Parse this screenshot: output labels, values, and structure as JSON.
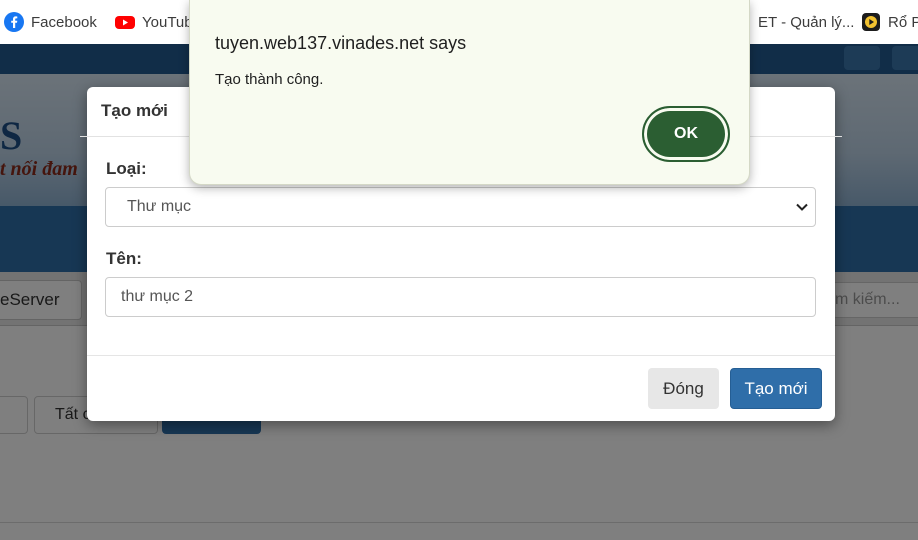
{
  "bookmarks": [
    {
      "label": "Facebook",
      "icon": "facebook-icon"
    },
    {
      "label": "YouTub",
      "icon": "youtube-icon"
    },
    {
      "label": "ET - Quản lý...",
      "icon": ""
    },
    {
      "label": "Rổ P",
      "icon": "play-icon"
    }
  ],
  "background": {
    "banner_logo": "S",
    "banner_slogan": "t nối đam",
    "subnav_tab": "eServer",
    "search_placeholder": "m kiếm...",
    "filter_button": "Tất c"
  },
  "modal": {
    "title": "Tạo mới",
    "type_label": "Loại:",
    "type_value": "Thư mục",
    "name_label": "Tên:",
    "name_value": "thư mục 2",
    "close_label": "Đóng",
    "create_label": "Tạo mới"
  },
  "alert": {
    "title": "tuyen.web137.vinades.net says",
    "message": "Tạo thành công.",
    "ok_label": "OK"
  },
  "colors": {
    "primary": "#2f6ea9",
    "ok_green": "#2b5e32",
    "alert_bg": "#f8fbf0"
  }
}
